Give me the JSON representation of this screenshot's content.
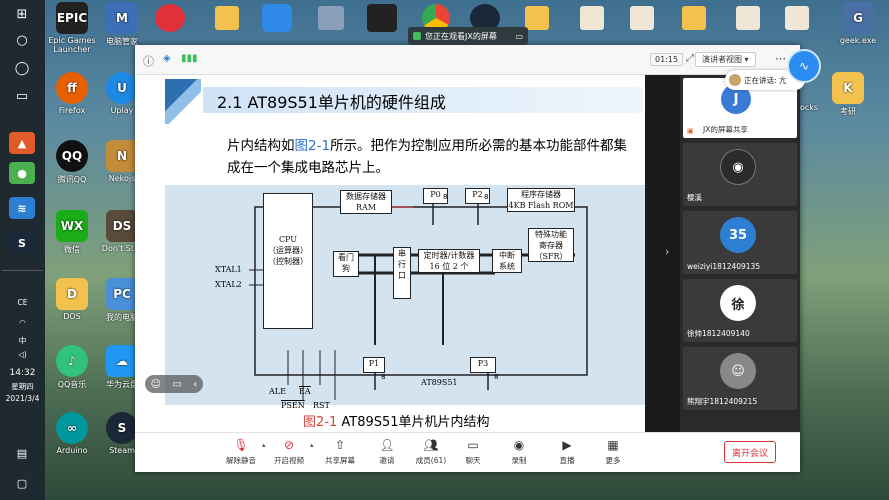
{
  "taskbar": {
    "time": "14:32",
    "weekday": "星期四",
    "date": "2021/3/4",
    "ime": "中",
    "lang": "CE"
  },
  "desktop": {
    "icons": [
      {
        "label": "Epic Games Launcher",
        "short": "EPIC"
      },
      {
        "label": "电脑管家",
        "short": "M"
      },
      {
        "label": "Firefox",
        "short": "ff"
      },
      {
        "label": "Uplay",
        "short": "U"
      },
      {
        "label": "腾讯QQ",
        "short": "QQ"
      },
      {
        "label": "Nekojs",
        "short": "N"
      },
      {
        "label": "微信",
        "short": "WX"
      },
      {
        "label": "Don't Star",
        "short": "DS"
      },
      {
        "label": "DOS",
        "short": "D"
      },
      {
        "label": "我的电脑",
        "short": "PC"
      },
      {
        "label": "QQ音乐",
        "short": "♪"
      },
      {
        "label": "华为云盘",
        "short": "☁"
      },
      {
        "label": "Arduino",
        "short": "∞"
      },
      {
        "label": "Steam",
        "short": "S"
      },
      {
        "label": "geek.exe",
        "short": "G"
      },
      {
        "label": "考研",
        "short": "K"
      }
    ]
  },
  "share_bar": {
    "text": "您正在观看JX的屏幕"
  },
  "window": {
    "timer": "01:15",
    "view_mode": "演讲者视图",
    "speaking": "正在讲话: 亢"
  },
  "slide": {
    "title": "2.1  AT89S51单片机的硬件组成",
    "para_a": "片内结构如",
    "para_ref": "图2-1",
    "para_b": "所示。把作为控制应用所必需的基本功能部件都集成在一个集成电路芯片上。",
    "caption_ref": "图2-1",
    "caption_text": "AT89S51单片机片内结构",
    "diagram": {
      "ram": "数据存储器\nRAM",
      "p0": "P0",
      "p2": "P2",
      "rom": "程序存储器\n4KB Flash ROM",
      "cpu": "CPU\n（运算器）\n（控制器）",
      "sfr": "特殊功能\n寄存器\n（SFR）",
      "wdt": "看门\n狗",
      "serial": "串\n行\n口",
      "timer": "定时器/计数器\n16 位 2 个",
      "int": "中断\n系统",
      "p1": "P1",
      "p3": "P3",
      "chip": "AT89S51",
      "xtal1": "XTAL1",
      "xtal2": "XTAL2",
      "ale": "ALE",
      "ea": "EA",
      "psen": "PSEN",
      "rst": "RST",
      "bus8": "8"
    }
  },
  "participants": [
    {
      "name": "JX的屏幕共享",
      "avatar": "J",
      "color": "#3a7bd5"
    },
    {
      "name": "樱溪",
      "avatar": "",
      "color": "#666"
    },
    {
      "name": "weiziyi1812409135",
      "avatar": "35",
      "color": "#2d7fd3"
    },
    {
      "name": "徐帅1812409140",
      "avatar": "徐",
      "color": "#eee"
    },
    {
      "name": "熊翔宇1812409215",
      "avatar": "",
      "color": "#888"
    }
  ],
  "toolbar": {
    "mute": "解除静音",
    "video": "开启视频",
    "share": "共享屏幕",
    "invite": "邀请",
    "members": "成员(61)",
    "chat": "聊天",
    "record": "录制",
    "live": "直播",
    "more": "更多",
    "leave": "离开会议"
  }
}
